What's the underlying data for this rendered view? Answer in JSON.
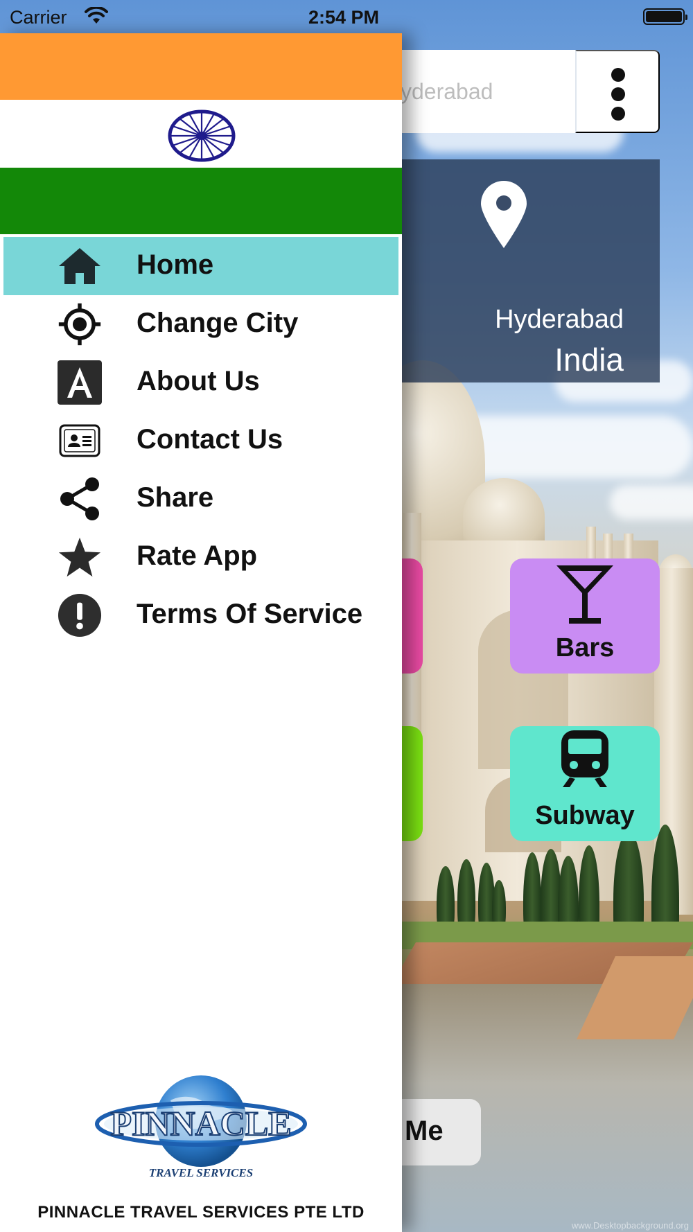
{
  "status_bar": {
    "carrier": "Carrier",
    "time": "2:54 PM"
  },
  "search": {
    "placeholder": "yderabad"
  },
  "location": {
    "city": "Hyderabad",
    "country": "India"
  },
  "tiles": [
    {
      "label": "Bars",
      "icon": "cocktail-glass-icon",
      "color": "#c98cf3"
    },
    {
      "label": "Subway",
      "icon": "train-icon",
      "color": "#5fe6cd"
    }
  ],
  "near_me": {
    "label": "Me"
  },
  "drawer": {
    "flag_colors": {
      "saffron": "#ff9933",
      "white": "#ffffff",
      "green": "#138808",
      "chakra": "#1f1b8c"
    },
    "menu": [
      {
        "label": "Home",
        "icon": "home-icon",
        "active": true
      },
      {
        "label": "Change City",
        "icon": "crosshair-icon",
        "active": false
      },
      {
        "label": "About Us",
        "icon": "letter-a-icon",
        "active": false
      },
      {
        "label": "Contact Us",
        "icon": "contact-card-icon",
        "active": false
      },
      {
        "label": "Share",
        "icon": "share-icon",
        "active": false
      },
      {
        "label": "Rate App",
        "icon": "star-icon",
        "active": false
      },
      {
        "label": "Terms Of Service",
        "icon": "exclamation-icon",
        "active": false
      }
    ],
    "footer": {
      "logo_text": "PINNACLE",
      "logo_subtext": "TRAVEL SERVICES",
      "company": "PINNACLE TRAVEL SERVICES PTE LTD"
    }
  },
  "colors": {
    "active_menu": "#79d6d7",
    "location_card": "#2c3e5a"
  }
}
